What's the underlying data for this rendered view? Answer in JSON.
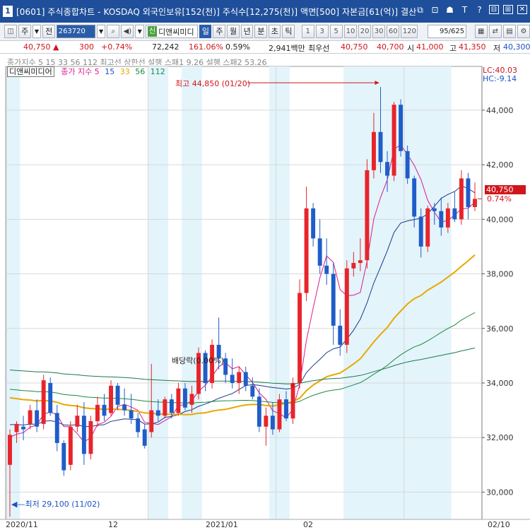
{
  "window": {
    "badge": "1",
    "title": "[0601] 주식종합차트 - KOSDAQ 외국인보유[152(천)] 주식수[12,275(천)] 액면[500] 자본금[61(억)] 결산",
    "controls": [
      "⧉",
      "⊡",
      "☗",
      "T",
      "?",
      "⊟",
      "⊞",
      "✕"
    ]
  },
  "toolbar": {
    "left_btn": "◫",
    "period_unit": "주",
    "period_drop": "▼",
    "prev_btn": "전",
    "code_value": "263720",
    "code_drop": "▼",
    "search_icon": "⌕",
    "sound_icon": "◀)",
    "menu_drop": "▼",
    "badge_new": "신",
    "stock_name": "디앤씨미디",
    "period_buttons": [
      "일",
      "주",
      "월",
      "년",
      "분",
      "초",
      "틱"
    ],
    "active_period": "일",
    "intervals": [
      "1",
      "3",
      "5",
      "10",
      "20",
      "30",
      "60",
      "120"
    ],
    "count_value": "95/625",
    "right_icons": [
      "▦",
      "⇄",
      "▤",
      "⚙"
    ]
  },
  "quote": {
    "price": "40,750 ▲",
    "change": "300",
    "change_pct": "+0.74%",
    "volume": "72,242",
    "volume_ratio": "161.06%",
    "turnover": "0.59%",
    "amount": "2,941백만",
    "pref_label": "최우선",
    "ask": "40,750",
    "bid": "40,700",
    "open_label": "시",
    "open": "41,000",
    "high_label": "고",
    "high": "41,350",
    "low_label": "저",
    "low": "40,300"
  },
  "legend": {
    "faded_line": "종가지수 5  15  33  56  112     최고선  상한선  설행 스패1 9.26  설행 스패2 53.26",
    "stock_name": "디앤씨미디어",
    "ma_label": "종가 지수",
    "ma_periods": [
      "5",
      "15",
      "33",
      "56",
      "112"
    ],
    "ma_colors": [
      "#d81b8c",
      "#1a50c8",
      "#e8a800",
      "#1c8a3c",
      "#1a8a5a"
    ]
  },
  "info": {
    "lc": "LC:40.03",
    "hc": "HC:-9.14"
  },
  "current": {
    "price": "40,750",
    "pct": "0.74%"
  },
  "annotations": {
    "high": "최고 44,850 (01/20)",
    "low": "최저 29,100 (11/02)",
    "dividend": "배당락(0.00%)"
  },
  "x_labels": [
    "2020/11",
    "12",
    "2021/01",
    "02",
    "02/10"
  ],
  "colors": {
    "up": "#e8242b",
    "down": "#1f5dc8",
    "shade": "#e3f4fb",
    "grid": "#d8d8d8",
    "ma5": "#d81b8c",
    "ma15": "#1a3a8a",
    "ma33": "#e8a800",
    "ma56": "#1c8a3c",
    "ma112": "#1a7a4a"
  },
  "chart_data": {
    "type": "candlestick",
    "ylim": [
      29000,
      45500
    ],
    "yticks": [
      30000,
      32000,
      34000,
      36000,
      38000,
      40000,
      42000,
      44000
    ],
    "ytick_labels": [
      "30,000",
      "32,000",
      "34,000",
      "36,000",
      "38,000",
      "40,000",
      "42,000",
      "44,000"
    ],
    "shaded_days": [
      [
        0,
        1
      ],
      [
        21,
        23
      ],
      [
        26,
        28
      ],
      [
        39,
        41
      ],
      [
        50,
        65
      ]
    ],
    "candles": [
      {
        "o": 31000,
        "h": 32300,
        "l": 29100,
        "c": 32100
      },
      {
        "o": 32200,
        "h": 32600,
        "l": 31800,
        "c": 32500
      },
      {
        "o": 32400,
        "h": 32800,
        "l": 31900,
        "c": 32300
      },
      {
        "o": 32500,
        "h": 33200,
        "l": 32300,
        "c": 33000
      },
      {
        "o": 33000,
        "h": 33400,
        "l": 32200,
        "c": 32400
      },
      {
        "o": 32500,
        "h": 34300,
        "l": 32300,
        "c": 34100
      },
      {
        "o": 34000,
        "h": 34200,
        "l": 32800,
        "c": 32900
      },
      {
        "o": 32900,
        "h": 33200,
        "l": 31500,
        "c": 31800
      },
      {
        "o": 31800,
        "h": 31900,
        "l": 30600,
        "c": 30800
      },
      {
        "o": 31000,
        "h": 32600,
        "l": 30800,
        "c": 32400
      },
      {
        "o": 32400,
        "h": 33200,
        "l": 32200,
        "c": 32800
      },
      {
        "o": 32800,
        "h": 33300,
        "l": 31000,
        "c": 31400
      },
      {
        "o": 31400,
        "h": 32800,
        "l": 31200,
        "c": 32600
      },
      {
        "o": 32600,
        "h": 33500,
        "l": 32400,
        "c": 33200
      },
      {
        "o": 33200,
        "h": 33600,
        "l": 32600,
        "c": 32800
      },
      {
        "o": 32900,
        "h": 34100,
        "l": 32800,
        "c": 33900
      },
      {
        "o": 33900,
        "h": 34000,
        "l": 33000,
        "c": 33200
      },
      {
        "o": 33200,
        "h": 33800,
        "l": 32800,
        "c": 33000
      },
      {
        "o": 33000,
        "h": 33600,
        "l": 32500,
        "c": 32700
      },
      {
        "o": 32700,
        "h": 32900,
        "l": 32000,
        "c": 32200
      },
      {
        "o": 32300,
        "h": 32500,
        "l": 31600,
        "c": 31700
      },
      {
        "o": 32200,
        "h": 34700,
        "l": 32000,
        "c": 33000
      },
      {
        "o": 33000,
        "h": 33400,
        "l": 32600,
        "c": 32800
      },
      {
        "o": 32800,
        "h": 33500,
        "l": 32700,
        "c": 33400
      },
      {
        "o": 33400,
        "h": 33600,
        "l": 32700,
        "c": 32900
      },
      {
        "o": 32900,
        "h": 34000,
        "l": 32800,
        "c": 33800
      },
      {
        "o": 33800,
        "h": 34000,
        "l": 33000,
        "c": 33100
      },
      {
        "o": 33200,
        "h": 33900,
        "l": 32900,
        "c": 33600
      },
      {
        "o": 33600,
        "h": 35300,
        "l": 33400,
        "c": 35100
      },
      {
        "o": 35100,
        "h": 35200,
        "l": 33700,
        "c": 34000
      },
      {
        "o": 34000,
        "h": 35600,
        "l": 33800,
        "c": 35400
      },
      {
        "o": 35400,
        "h": 36400,
        "l": 34500,
        "c": 34900
      },
      {
        "o": 34900,
        "h": 35100,
        "l": 34000,
        "c": 34300
      },
      {
        "o": 34300,
        "h": 34900,
        "l": 33800,
        "c": 34000
      },
      {
        "o": 34000,
        "h": 34600,
        "l": 33600,
        "c": 34400
      },
      {
        "o": 34400,
        "h": 34600,
        "l": 33700,
        "c": 33900
      },
      {
        "o": 33900,
        "h": 34200,
        "l": 33400,
        "c": 33500
      },
      {
        "o": 33500,
        "h": 33800,
        "l": 32200,
        "c": 32400
      },
      {
        "o": 32400,
        "h": 33100,
        "l": 31700,
        "c": 32800
      },
      {
        "o": 32800,
        "h": 33300,
        "l": 32100,
        "c": 32300
      },
      {
        "o": 32300,
        "h": 33600,
        "l": 32200,
        "c": 33400
      },
      {
        "o": 33400,
        "h": 33700,
        "l": 32600,
        "c": 32700
      },
      {
        "o": 32700,
        "h": 34200,
        "l": 32500,
        "c": 34000
      },
      {
        "o": 34000,
        "h": 37800,
        "l": 33800,
        "c": 37300
      },
      {
        "o": 37300,
        "h": 41200,
        "l": 37000,
        "c": 40400
      },
      {
        "o": 40400,
        "h": 40600,
        "l": 39000,
        "c": 39300
      },
      {
        "o": 39300,
        "h": 40000,
        "l": 38000,
        "c": 38300
      },
      {
        "o": 38300,
        "h": 39300,
        "l": 37600,
        "c": 38000
      },
      {
        "o": 38000,
        "h": 38400,
        "l": 35400,
        "c": 36100
      },
      {
        "o": 36100,
        "h": 36700,
        "l": 35000,
        "c": 35400
      },
      {
        "o": 35400,
        "h": 38500,
        "l": 35100,
        "c": 38200
      },
      {
        "o": 38200,
        "h": 38800,
        "l": 37900,
        "c": 38400
      },
      {
        "o": 38400,
        "h": 39300,
        "l": 38100,
        "c": 38500
      },
      {
        "o": 38500,
        "h": 42200,
        "l": 38200,
        "c": 41800
      },
      {
        "o": 41800,
        "h": 43900,
        "l": 41500,
        "c": 43200
      },
      {
        "o": 43200,
        "h": 44850,
        "l": 41700,
        "c": 42100
      },
      {
        "o": 42100,
        "h": 42500,
        "l": 41000,
        "c": 41600
      },
      {
        "o": 41600,
        "h": 44300,
        "l": 41400,
        "c": 44200
      },
      {
        "o": 44200,
        "h": 44400,
        "l": 42300,
        "c": 42500
      },
      {
        "o": 42500,
        "h": 42700,
        "l": 41300,
        "c": 41500
      },
      {
        "o": 41500,
        "h": 41600,
        "l": 39700,
        "c": 40100
      },
      {
        "o": 40100,
        "h": 40400,
        "l": 38600,
        "c": 39000
      },
      {
        "o": 39000,
        "h": 40500,
        "l": 38800,
        "c": 40400
      },
      {
        "o": 40400,
        "h": 40600,
        "l": 39800,
        "c": 40300
      },
      {
        "o": 40300,
        "h": 40800,
        "l": 39400,
        "c": 39700
      },
      {
        "o": 39700,
        "h": 40600,
        "l": 39500,
        "c": 40400
      },
      {
        "o": 40400,
        "h": 41000,
        "l": 39900,
        "c": 40000
      },
      {
        "o": 40000,
        "h": 41800,
        "l": 39800,
        "c": 41500
      },
      {
        "o": 41500,
        "h": 41700,
        "l": 40000,
        "c": 40450
      },
      {
        "o": 40450,
        "h": 41350,
        "l": 40300,
        "c": 40750
      }
    ]
  }
}
